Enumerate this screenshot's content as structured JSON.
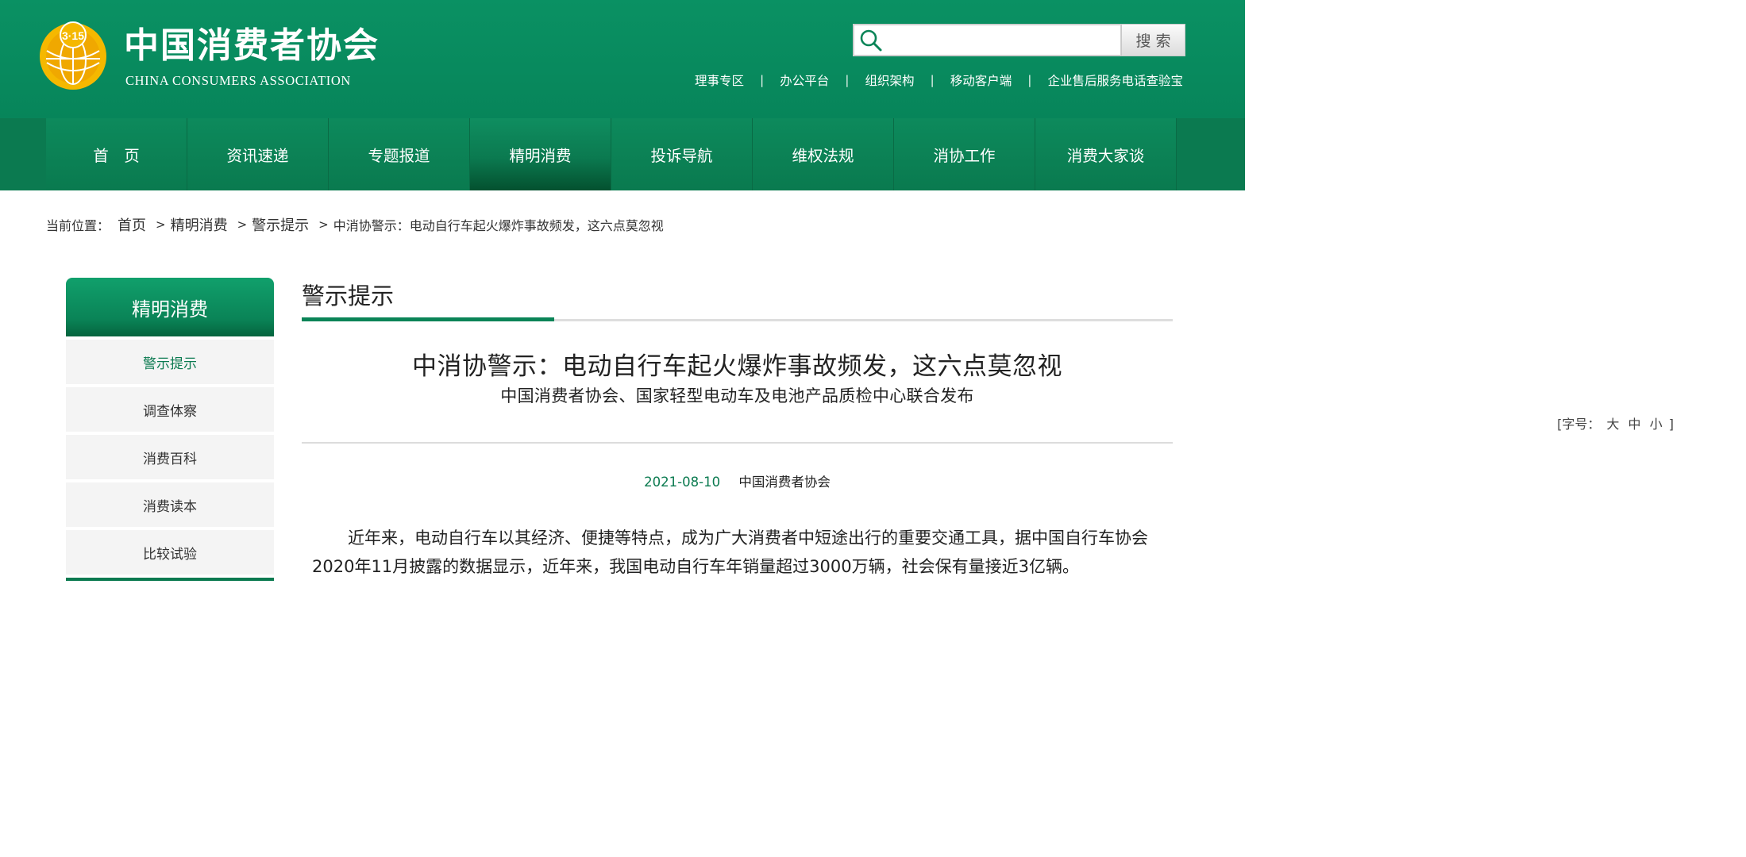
{
  "header": {
    "logo_cn": "中国消费者协会",
    "logo_en": "CHINA CONSUMERS ASSOCIATION",
    "emblem_text": "3·15",
    "search": {
      "placeholder": "",
      "button_label": "搜索"
    },
    "top_links": [
      "理事专区",
      "办公平台",
      "组织架构",
      "移动客户端",
      "企业售后服务电话查验宝"
    ],
    "separator": "|"
  },
  "nav": {
    "items": [
      "首　页",
      "资讯速递",
      "专题报道",
      "精明消费",
      "投诉导航",
      "维权法规",
      "消协工作",
      "消费大家谈"
    ],
    "active_index": 3
  },
  "breadcrumb": {
    "prefix": "当前位置：",
    "items": [
      "首页",
      "精明消费",
      "警示提示"
    ],
    "arrow": ">",
    "current": "中消协警示：电动自行车起火爆炸事故频发，这六点莫忽视"
  },
  "sidebar": {
    "title": "精明消费",
    "items": [
      "警示提示",
      "调查体察",
      "消费百科",
      "消费读本",
      "比较试验"
    ],
    "active_index": 0
  },
  "main": {
    "section_title": "警示提示",
    "article_title": "中消协警示：电动自行车起火爆炸事故频发，这六点莫忽视",
    "article_subtitle": "中国消费者协会、国家轻型电动车及电池产品质检中心联合发布",
    "font_size_label": "[字号：",
    "font_size_large": "大",
    "font_size_medium": "中",
    "font_size_small": "小",
    "font_size_close": "]",
    "date": "2021-08-10",
    "source": "中国消费者协会",
    "paragraph": "近年来，电动自行车以其经济、便捷等特点，成为广大消费者中短途出行的重要交通工具，据中国自行车协会2020年11月披露的数据显示，近年来，我国电动自行车年销量超过3000万辆，社会保有量接近3亿辆。"
  },
  "colors": {
    "brand_green": "#0a8457",
    "nav_green": "#0b7a50",
    "emblem_gold": "#f5b800",
    "date_green": "#0a7a4f"
  }
}
